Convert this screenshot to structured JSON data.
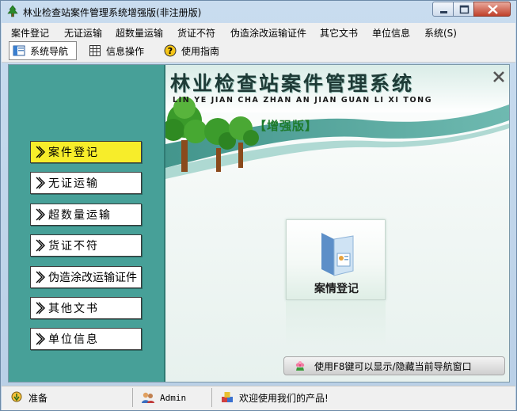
{
  "window": {
    "title": "林业检查站案件管理系统增强版(非注册版)"
  },
  "menubar": {
    "items": [
      "案件登记",
      "无证运输",
      "超数量运输",
      "货证不符",
      "伪造涂改运输证件",
      "其它文书",
      "单位信息",
      "系统(S)"
    ]
  },
  "toolbar": {
    "items": [
      {
        "label": "系统导航",
        "icon": "navigation-icon",
        "active": true
      },
      {
        "label": "信息操作",
        "icon": "grid-icon",
        "active": false
      },
      {
        "label": "使用指南",
        "icon": "help-icon",
        "active": false
      }
    ]
  },
  "sidebar": {
    "items": [
      {
        "label": "案件登记",
        "active": true
      },
      {
        "label": "无证运输",
        "active": false
      },
      {
        "label": "超数量运输",
        "active": false
      },
      {
        "label": "货证不符",
        "active": false
      },
      {
        "label": "伪造涂改运输证件",
        "active": false
      },
      {
        "label": "其他文书",
        "active": false
      },
      {
        "label": "单位信息",
        "active": false
      }
    ]
  },
  "banner": {
    "title": "林业检查站案件管理系统",
    "pinyin": "LIN YE JIAN CHA ZHAN AN JIAN GUAN LI XI TONG",
    "edition": "【增强版】"
  },
  "card": {
    "label": "案情登记"
  },
  "hint": {
    "text": "使用F8键可以显示/隐藏当前导航窗口"
  },
  "statusbar": {
    "status": "准备",
    "user": "Admin",
    "welcome": "欢迎使用我们的产品!"
  },
  "colors": {
    "sidebar": "#47a098",
    "active_nav": "#f7ed2a",
    "edition": "#1d7a2c"
  }
}
